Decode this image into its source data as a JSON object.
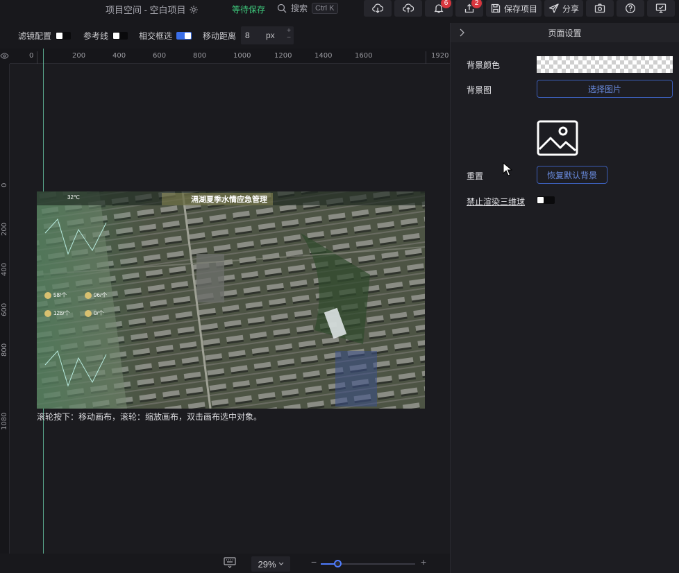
{
  "topbar": {
    "title": "项目空间 - 空白项目",
    "save_status": "等待保存",
    "search_label": "搜索",
    "search_shortcut": "Ctrl K",
    "notification_count": "6",
    "upload_count": "2",
    "save_project_label": "保存项目",
    "share_label": "分享"
  },
  "toolbar": {
    "filter_label": "滤镜配置",
    "guides_label": "参考线",
    "intersect_label": "相交框选",
    "move_distance_label": "移动距离",
    "move_distance_value": "8",
    "move_distance_unit": "px"
  },
  "rulers": {
    "h_labels": [
      "0",
      "200",
      "400",
      "600",
      "800",
      "1000",
      "1200",
      "1400",
      "1600",
      "1920"
    ],
    "v_labels": [
      "0",
      "200",
      "400",
      "600",
      "800",
      "1080"
    ]
  },
  "canvas": {
    "dashboard_title": "滆湖夏季水情应急管理",
    "temperature": "32℃",
    "stat_values": [
      "58/个",
      "96/个",
      "128/个",
      "0/个"
    ],
    "hint": "滚轮按下：移动画布，滚轮：缩放画布，双击画布选中对象。"
  },
  "bottombar": {
    "zoom": "29%",
    "zoom_fraction": 0.18
  },
  "panel": {
    "header": "页面设置",
    "bg_color_label": "背景颜色",
    "bg_image_label": "背景图",
    "select_image_button": "选择图片",
    "reset_label": "重置",
    "restore_default_button": "恢复默认背景",
    "disable_globe_label": "禁止渲染三维球"
  },
  "colors": {
    "accent": "#3a6ee8",
    "save_status": "#3ec97c",
    "badge": "#d9363e",
    "guide": "#6fd6b0"
  }
}
